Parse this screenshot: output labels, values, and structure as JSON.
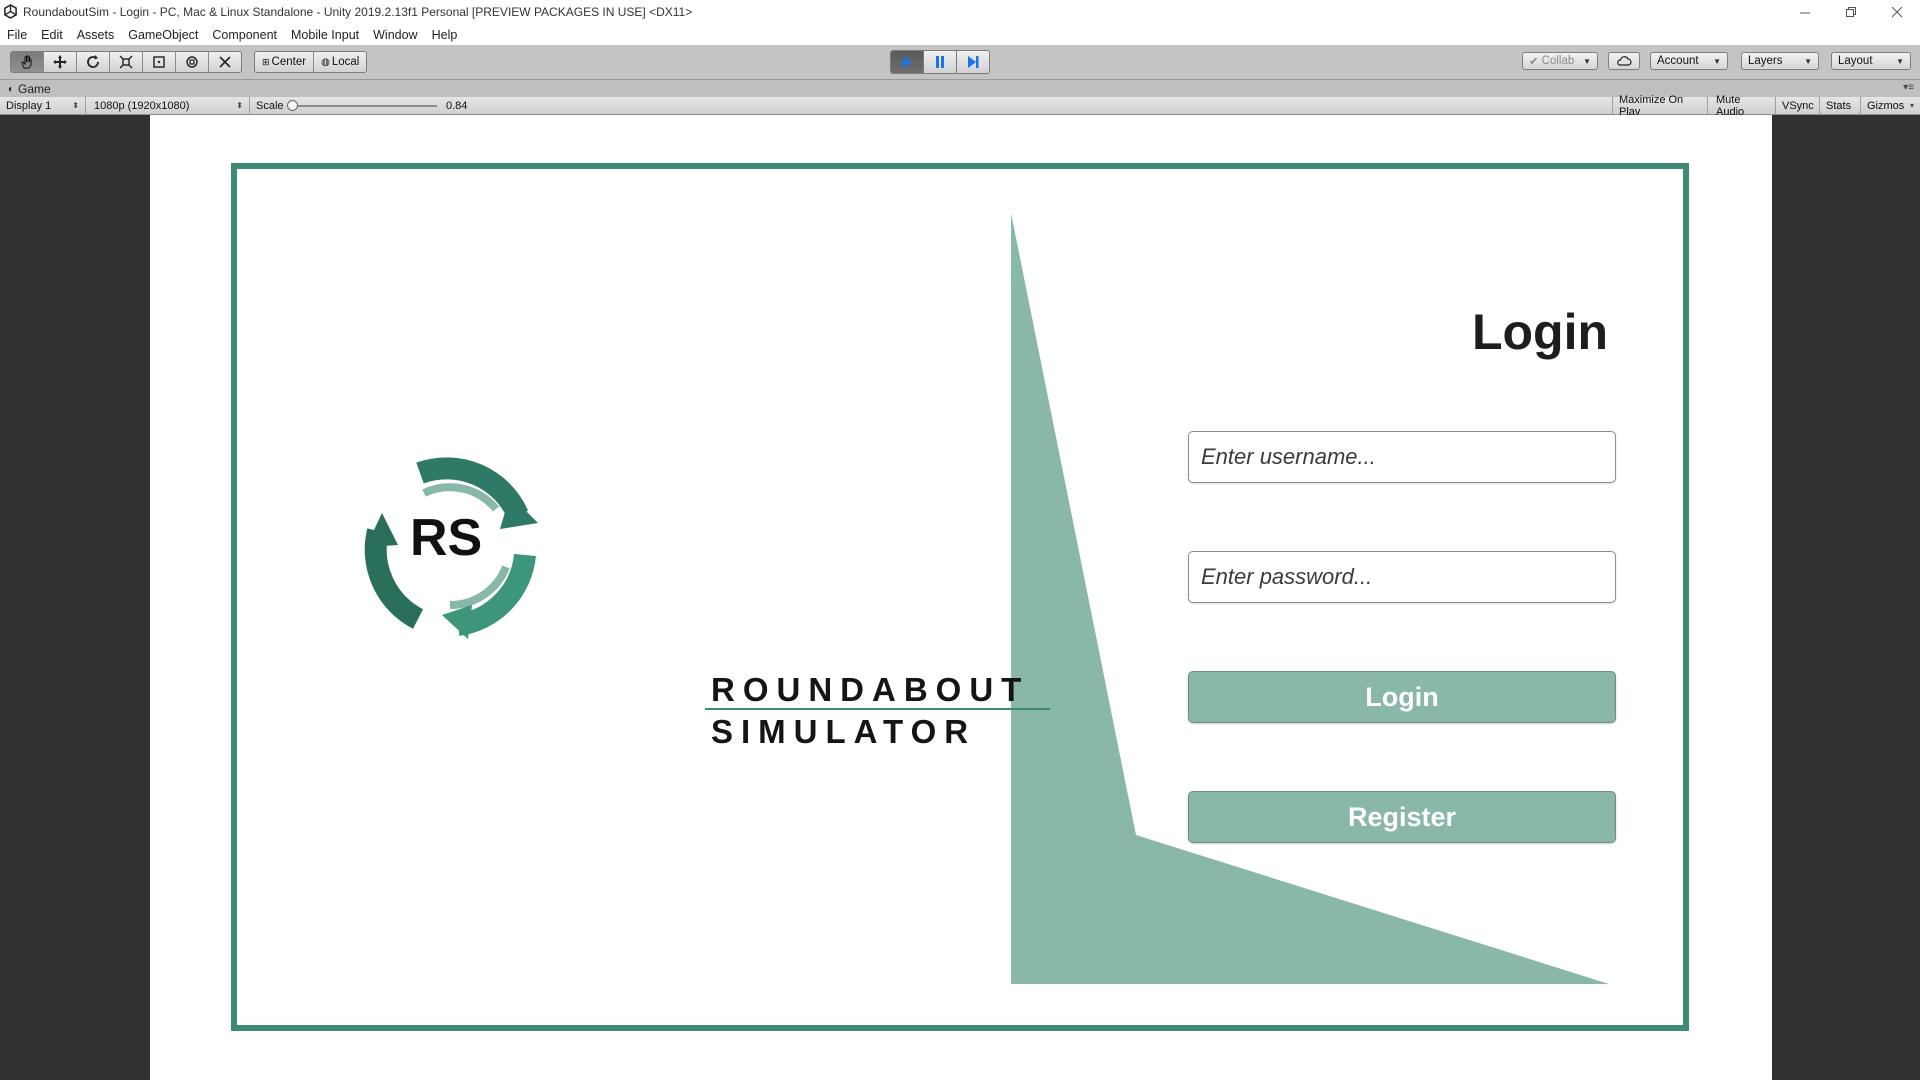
{
  "window": {
    "title": "RoundaboutSim - Login - PC, Mac & Linux Standalone - Unity 2019.2.13f1 Personal [PREVIEW PACKAGES IN USE] <DX11>"
  },
  "menu": [
    "File",
    "Edit",
    "Assets",
    "GameObject",
    "Component",
    "Mobile Input",
    "Window",
    "Help"
  ],
  "toolbar": {
    "tools": [
      "hand-tool",
      "move-tool",
      "rotate-tool",
      "scale-tool",
      "rect-tool",
      "transform-tool",
      "custom-tool"
    ],
    "pivot_label": "Center",
    "rotation_label": "Local",
    "collab_label": "Collab",
    "account_label": "Account",
    "layers_label": "Layers",
    "layout_label": "Layout"
  },
  "game_tab": {
    "label": "Game"
  },
  "game_bar": {
    "display": "Display 1",
    "resolution": "1080p (1920x1080)",
    "scale_label": "Scale",
    "scale_value": "0.84",
    "scale_fraction": 0.02,
    "toggles": [
      "Maximize On Play",
      "Mute Audio",
      "VSync",
      "Stats",
      "Gizmos"
    ]
  },
  "game": {
    "logo_letters": "RS",
    "logo_line1": "ROUNDABOUT",
    "logo_line2": "SIMULATOR",
    "login_title": "Login",
    "username_placeholder": "Enter username...",
    "password_placeholder": "Enter password...",
    "login_button": "Login",
    "register_button": "Register"
  },
  "colors": {
    "frame": "#3f8a77",
    "accent_light": "#8ab8a8",
    "logo_teal": "#2f7a66"
  }
}
